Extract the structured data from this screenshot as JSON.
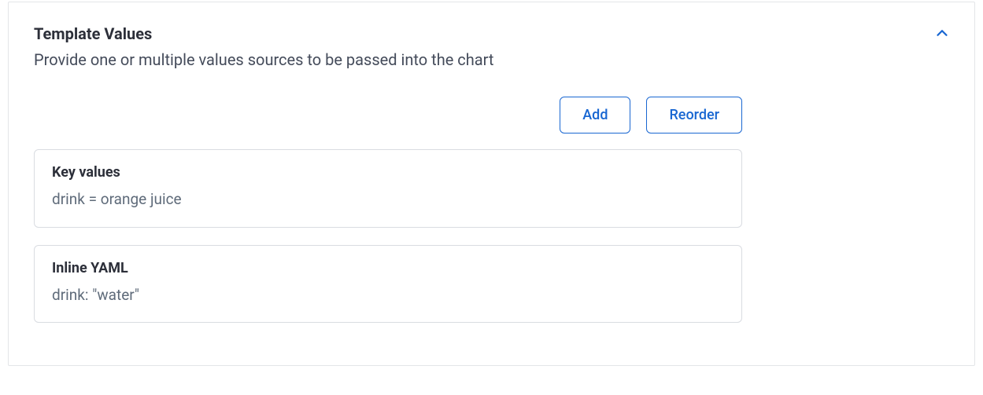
{
  "section": {
    "title": "Template Values",
    "description": "Provide one or multiple values sources to be passed into the chart"
  },
  "buttons": {
    "add": "Add",
    "reorder": "Reorder"
  },
  "cards": [
    {
      "title": "Key values",
      "value": "drink = orange juice"
    },
    {
      "title": "Inline YAML",
      "value": "drink: \"water\""
    }
  ]
}
